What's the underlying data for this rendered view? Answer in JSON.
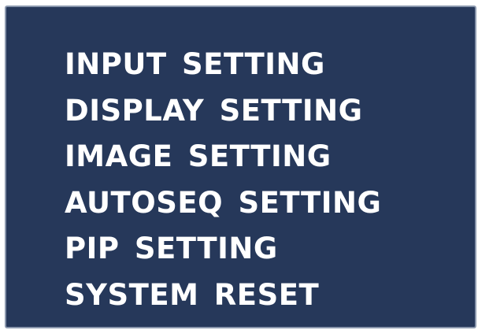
{
  "menu": {
    "items": [
      {
        "label": "INPUT SETTING"
      },
      {
        "label": "DISPLAY SETTING"
      },
      {
        "label": "IMAGE SETTING"
      },
      {
        "label": "AUTOSEQ SETTING"
      },
      {
        "label": "PIP SETTING"
      },
      {
        "label": "SYSTEM RESET"
      }
    ]
  },
  "colors": {
    "panel_background": "#26385a",
    "panel_border": "#8a97ad",
    "text": "#ffffff"
  }
}
